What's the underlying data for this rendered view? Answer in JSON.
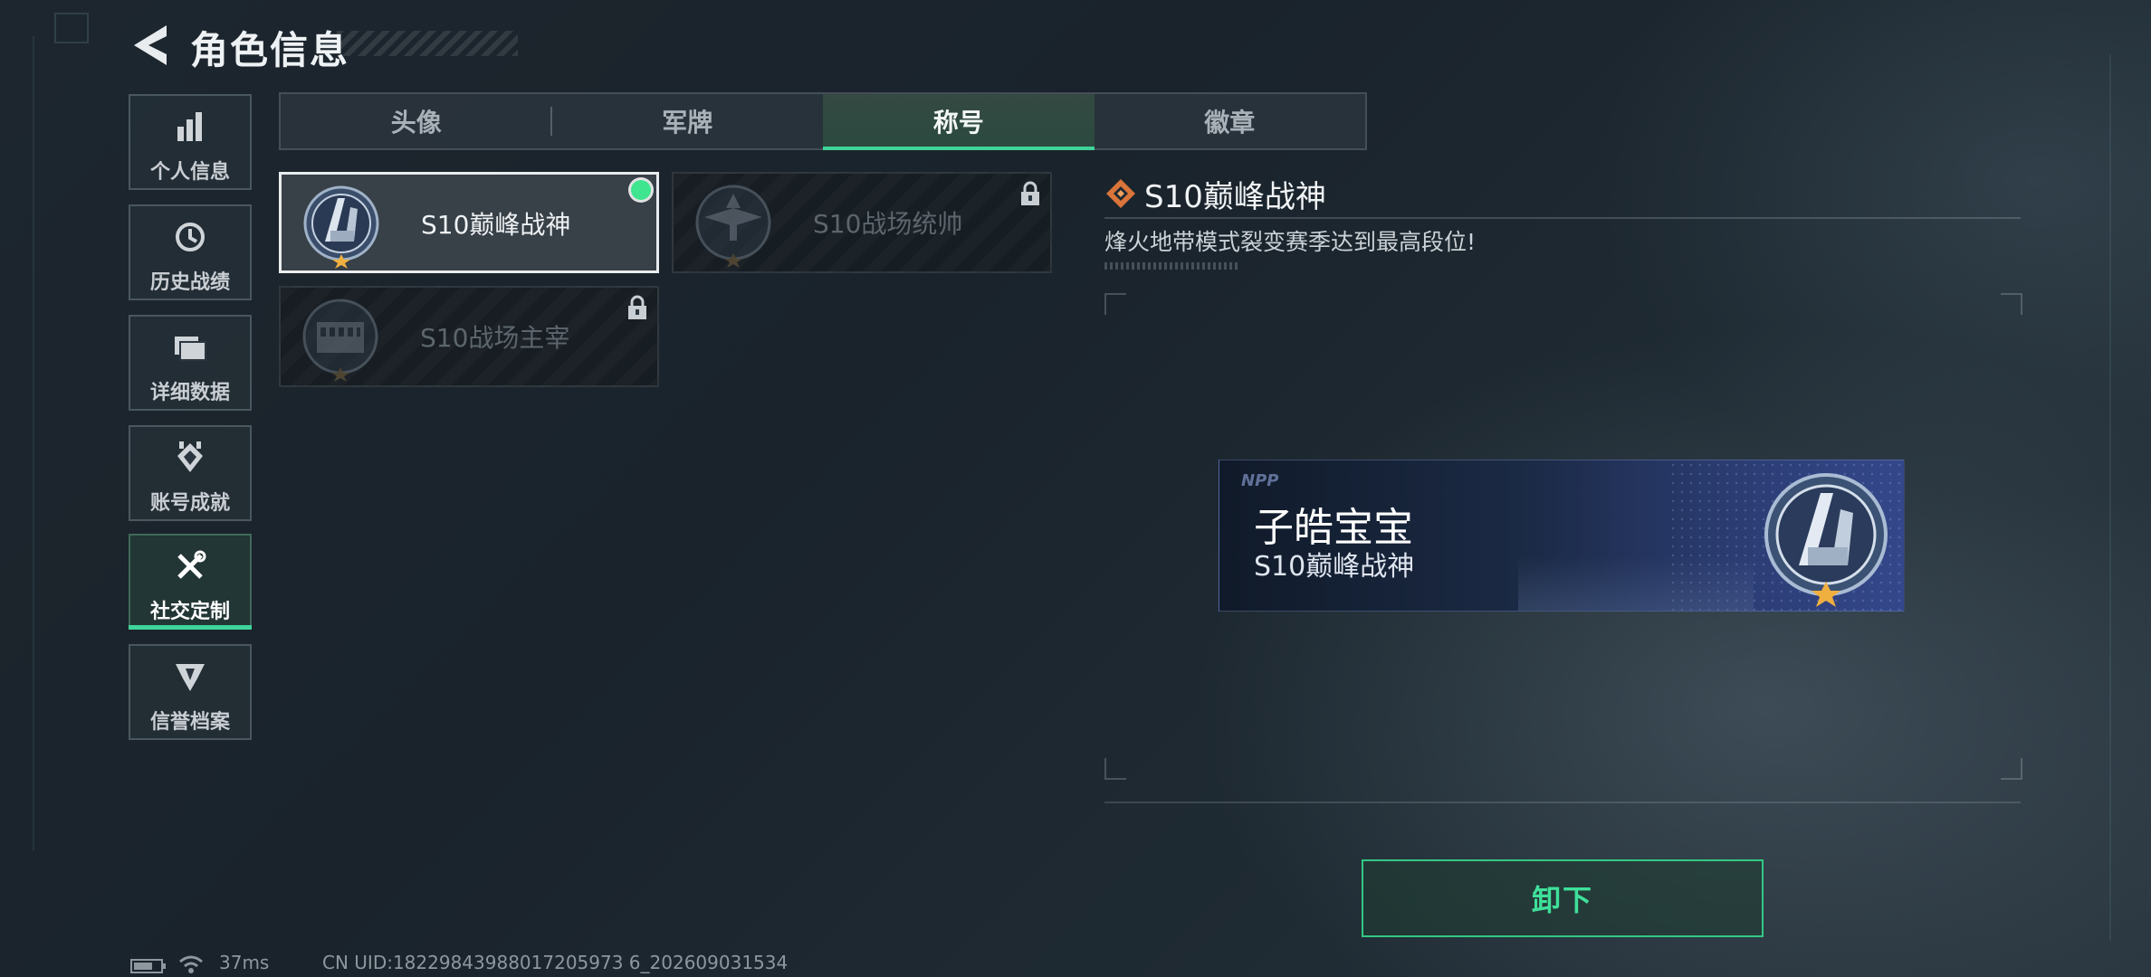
{
  "header": {
    "title": "角色信息"
  },
  "sidebar": {
    "items": [
      {
        "label": "个人信息",
        "icon": "bar-chart-icon"
      },
      {
        "label": "历史战绩",
        "icon": "history-clock-icon"
      },
      {
        "label": "详细数据",
        "icon": "folder-data-icon"
      },
      {
        "label": "账号成就",
        "icon": "achievement-icon"
      },
      {
        "label": "社交定制",
        "icon": "tools-icon",
        "active": true
      },
      {
        "label": "信誉档案",
        "icon": "credit-emblem-icon"
      }
    ]
  },
  "tabs": [
    {
      "label": "头像"
    },
    {
      "label": "军牌"
    },
    {
      "label": "称号",
      "active": true
    },
    {
      "label": "徽章"
    }
  ],
  "titles": [
    {
      "name": "S10巅峰战神",
      "state": "equipped"
    },
    {
      "name": "S10战场统帅",
      "state": "locked"
    },
    {
      "name": "S10战场主宰",
      "state": "locked"
    }
  ],
  "detail": {
    "title": "S10巅峰战神",
    "description": "烽火地带模式裂变赛季达到最高段位!"
  },
  "nameplate": {
    "logo": "NPP",
    "player_name": "子皓宝宝",
    "title": "S10巅峰战神"
  },
  "action": {
    "label": "卸下"
  },
  "status_bar": {
    "ping": "37ms",
    "uid": "CN UID:18229843988017205973 6_202609031534"
  },
  "colors": {
    "accent_green": "#3fd49a",
    "equipped_dot": "#3fe58f",
    "star_gold": "#f0b040"
  }
}
